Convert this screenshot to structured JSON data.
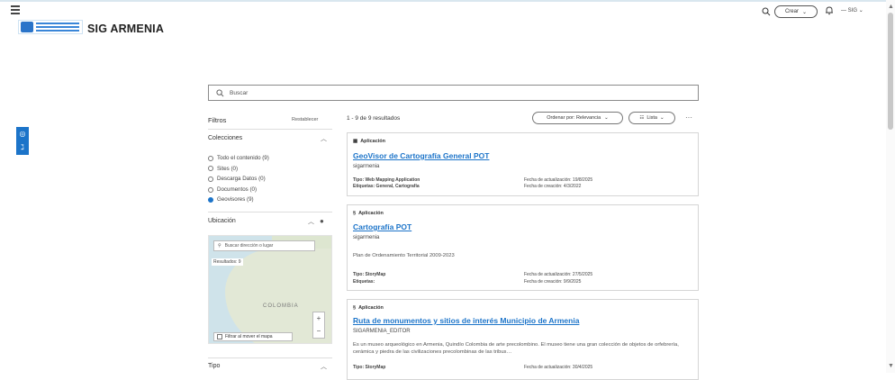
{
  "header": {
    "site_title": "SIG ARMENIA",
    "crear_label": "Crear",
    "user_label": "SIG"
  },
  "search": {
    "placeholder": "Buscar"
  },
  "filters": {
    "title": "Filtros",
    "reset": "Restablecer",
    "collections": {
      "title": "Colecciones",
      "items": [
        {
          "label": "Todo el contenido (9)",
          "selected": false
        },
        {
          "label": "Sites (0)",
          "selected": false
        },
        {
          "label": "Descarga Datos (0)",
          "selected": false
        },
        {
          "label": "Documentos (0)",
          "selected": false
        },
        {
          "label": "Geovisores (9)",
          "selected": true
        }
      ]
    },
    "location": {
      "title": "Ubicación",
      "map_search_placeholder": "Buscar dirección o lugar",
      "map_results": "Resultados: 9",
      "map_country_label": "COLOMBIA",
      "filter_on_move": "Filtrar al mover el mapa"
    },
    "type": {
      "title": "Tipo"
    }
  },
  "results": {
    "count_text": "1 - 9 de 9 resultados",
    "sort_label": "Ordenar por: Relevancia",
    "view_label": "Lista",
    "items": [
      {
        "type": "Aplicación",
        "title": "GeoVisor de Cartografía General POT",
        "owner": "sigarmenia",
        "description": "",
        "tipo": "Tipo: Web Mapping Application",
        "etiquetas": "Etiquetas: General, Cartografía",
        "actualizacion": "Fecha de actualización: 19/8/2025",
        "creacion": "Fecha de creación: 4/3/2022"
      },
      {
        "type": "Aplicación",
        "title": "Cartografía POT",
        "owner": "sigarmenia",
        "description": "Plan de Ordenamiento Territorial 2009-2023",
        "tipo": "Tipo: StoryMap",
        "etiquetas": "Etiquetas:",
        "actualizacion": "Fecha de actualización: 27/5/2025",
        "creacion": "Fecha de creación: 9/9/2025"
      },
      {
        "type": "Aplicación",
        "title": "Ruta de monumentos y sitios de interés Municipio de Armenia",
        "owner": "SIGARMENIA_EDITOR",
        "description": "Es un museo arqueológico en Armenia, Quindío Colombia de arte precolombino. El museo tiene una gran colección de objetos de orfebrería, cerámica y piedra de las civilizaciones precolombinas de las tribus…",
        "tipo": "Tipo: StoryMap",
        "etiquetas": "",
        "actualizacion": "Fecha de actualización: 30/4/2025",
        "creacion": ""
      }
    ]
  }
}
